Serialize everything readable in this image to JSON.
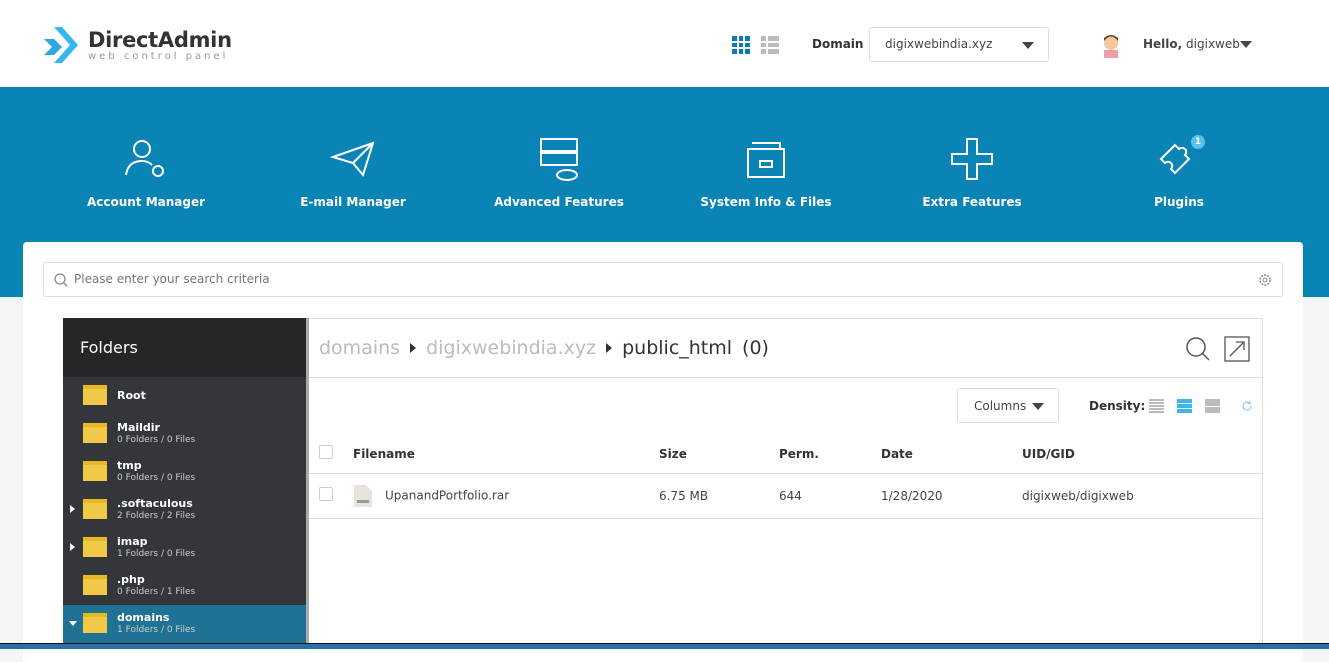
{
  "logo": {
    "name": "DirectAdmin",
    "tagline": "web control panel"
  },
  "header": {
    "domain_label": "Domain",
    "domain_value": "digixwebindia.xyz",
    "hello_prefix": "Hello,",
    "username": "digixweb"
  },
  "nav": [
    {
      "label": "Account Manager"
    },
    {
      "label": "E-mail Manager"
    },
    {
      "label": "Advanced Features"
    },
    {
      "label": "System Info & Files"
    },
    {
      "label": "Extra Features"
    },
    {
      "label": "Plugins",
      "badge": "1"
    }
  ],
  "search": {
    "placeholder": "Please enter your search criteria"
  },
  "folders": {
    "title": "Folders",
    "items": [
      {
        "name": "Root",
        "count": ""
      },
      {
        "name": "Maildir",
        "count": "0 Folders / 0 Files"
      },
      {
        "name": "tmp",
        "count": "0 Folders / 0 Files"
      },
      {
        "name": ".softaculous",
        "count": "2 Folders / 2 Files"
      },
      {
        "name": "imap",
        "count": "1 Folders / 0 Files"
      },
      {
        "name": ".php",
        "count": "0 Folders / 1 Files"
      },
      {
        "name": "domains",
        "count": "1 Folders / 0 Files"
      }
    ]
  },
  "breadcrumb": {
    "items": [
      "domains",
      "digixwebindia.xyz"
    ],
    "current": "public_html",
    "count": "(0)"
  },
  "toolbar": {
    "columns": "Columns",
    "density": "Density:"
  },
  "table": {
    "headers": [
      "Filename",
      "Size",
      "Perm.",
      "Date",
      "UID/GID"
    ],
    "rows": [
      {
        "filename": "UpanandPortfolio.rar",
        "size": "6.75 MB",
        "perm": "644",
        "date": "1/28/2020",
        "uid": "digixweb/digixweb"
      }
    ]
  },
  "colors": {
    "brand": "#0a83b5",
    "sidebar": "#33363b",
    "selected": "#1f7293"
  }
}
